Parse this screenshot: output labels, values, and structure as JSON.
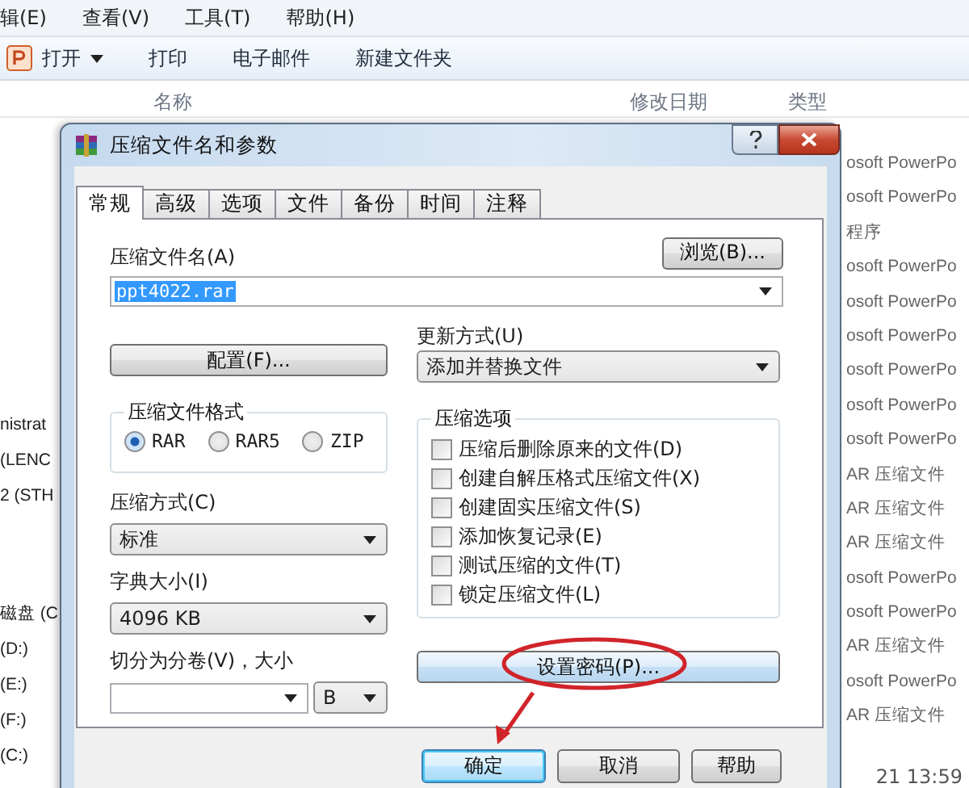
{
  "explorer": {
    "menu": [
      "辑(E)",
      "查看(V)",
      "工具(T)",
      "帮助(H)"
    ],
    "toolbar": [
      {
        "label": "打开",
        "kind": "dropdown"
      },
      {
        "label": "打印",
        "kind": "plain"
      },
      {
        "label": "电子邮件",
        "kind": "plain"
      },
      {
        "label": "新建文件夹",
        "kind": "plain"
      }
    ],
    "columns": [
      "名称",
      "修改日期",
      "类型"
    ],
    "nav_groups": [
      {
        "items": [
          "nistrat",
          "(LENC",
          "2 (STH"
        ]
      },
      {
        "items": [
          "磁盘 (C",
          "(D:)",
          "(E:)",
          "(F:)",
          "(C:)"
        ]
      }
    ],
    "type_cells": [
      "osoft PowerPo",
      "osoft PowerPo",
      "程序",
      "osoft PowerPo",
      "osoft PowerPo",
      "osoft PowerPo",
      "osoft PowerPo",
      "osoft PowerPo",
      "osoft PowerPo",
      "AR 压缩文件",
      "AR 压缩文件",
      "AR 压缩文件",
      "osoft PowerPo",
      "osoft PowerPo",
      "AR 压缩文件",
      "osoft PowerPo",
      "AR 压缩文件"
    ],
    "status_time": "21 13:59"
  },
  "dialog": {
    "title": "压缩文件名和参数",
    "tabs": [
      {
        "label": "常规",
        "selected": true
      },
      {
        "label": "高级",
        "selected": false
      },
      {
        "label": "选项",
        "selected": false
      },
      {
        "label": "文件",
        "selected": false
      },
      {
        "label": "备份",
        "selected": false
      },
      {
        "label": "时间",
        "selected": false
      },
      {
        "label": "注释",
        "selected": false
      }
    ],
    "archive_name_label": "压缩文件名(A)",
    "browse_button": "浏览(B)...",
    "archive_name_value": "ppt4022.rar",
    "update_mode_label": "更新方式(U)",
    "update_mode_value": "添加并替换文件",
    "profiles_button": "配置(F)...",
    "format_group": {
      "title": "压缩文件格式",
      "options": [
        {
          "label": "RAR",
          "selected": true
        },
        {
          "label": "RAR5",
          "selected": false
        },
        {
          "label": "ZIP",
          "selected": false
        }
      ]
    },
    "method_label": "压缩方式(C)",
    "method_value": "标准",
    "dictionary_label": "字典大小(I)",
    "dictionary_value": "4096 KB",
    "split_label": "切分为分卷(V)，大小",
    "split_unit": "B",
    "options_group": {
      "title": "压缩选项",
      "items": [
        {
          "label": "压缩后删除原来的文件(D)",
          "checked": false
        },
        {
          "label": "创建自解压格式压缩文件(X)",
          "checked": false
        },
        {
          "label": "创建固实压缩文件(S)",
          "checked": false
        },
        {
          "label": "添加恢复记录(E)",
          "checked": false
        },
        {
          "label": "测试压缩的文件(T)",
          "checked": false
        },
        {
          "label": "锁定压缩文件(L)",
          "checked": false
        }
      ]
    },
    "password_button": "设置密码(P)...",
    "buttons": [
      {
        "label": "确定",
        "default": true
      },
      {
        "label": "取消",
        "default": false
      },
      {
        "label": "帮助",
        "default": false
      }
    ]
  }
}
